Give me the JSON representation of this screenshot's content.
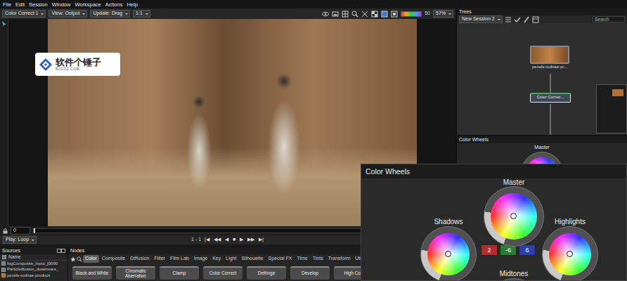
{
  "menu": [
    "File",
    "Edit",
    "Session",
    "Window",
    "Workspace",
    "Actions",
    "Help"
  ],
  "toolbar": {
    "node_select": "Color Correct 1",
    "view": "View: Output",
    "update": "Update: Drag",
    "zoom_ratio": "1:1",
    "exposure": "50",
    "zoom": "57%"
  },
  "watermark": {
    "title": "软件个锤子",
    "url": "RJGCZ.COM"
  },
  "timeline": {
    "frame": "0"
  },
  "playbar": {
    "mode": "Play: Loop",
    "range": "1 - 1",
    "transport": [
      "|◀",
      "◀◀",
      "◀",
      "■",
      "▶",
      "▶▶",
      "▶|"
    ]
  },
  "trees": {
    "title": "Trees",
    "session": "New Session 2",
    "search": "Search",
    "nodes": [
      {
        "label": "pexels-rodnae-pr...",
        "selected": false
      },
      {
        "label": "Color Correc...",
        "selected": true
      }
    ]
  },
  "color_wheels_panel": {
    "title": "Color Wheels",
    "master": "Master"
  },
  "color_wheels_zoom": {
    "title": "Color Wheels",
    "wheels": [
      {
        "name": "Master"
      },
      {
        "name": "Shadows"
      },
      {
        "name": "Highlights"
      },
      {
        "name": "Midtones"
      }
    ],
    "values": [
      {
        "text": "2",
        "color": "#b52a2a"
      },
      {
        "text": "-6",
        "color": "#2d7a35"
      },
      {
        "text": "6",
        "color": "#2a3fa8"
      }
    ]
  },
  "sources": {
    "title": "Sources",
    "column": "Name",
    "items": [
      {
        "name": "fogComposite_Input_[0000",
        "kind": "sequence"
      },
      {
        "name": "ParticleIllusion_dustmotes_",
        "kind": "sequence"
      },
      {
        "name": "pexels-rodnae-producti",
        "kind": "image"
      }
    ]
  },
  "nodes": {
    "title": "Nodes",
    "tabs": [
      {
        "label": "Color",
        "selected": true
      },
      {
        "label": "Composite",
        "selected": false
      },
      {
        "label": "Diffusion",
        "selected": false
      },
      {
        "label": "Filter",
        "selected": false
      },
      {
        "label": "Film Lab",
        "selected": false
      },
      {
        "label": "Image",
        "selected": false
      },
      {
        "label": "Key",
        "selected": false
      },
      {
        "label": "Light",
        "selected": false
      },
      {
        "label": "Silhouette",
        "selected": false
      },
      {
        "label": "Special FX",
        "selected": false
      },
      {
        "label": "Time",
        "selected": false
      },
      {
        "label": "Tints",
        "selected": false
      },
      {
        "label": "Transform",
        "selected": false
      },
      {
        "label": "Utility",
        "selected": false
      }
    ],
    "buttons": [
      "Black and White",
      "Chromatic Aberration",
      "Clamp",
      "Color Correct",
      "Defringe",
      "Develop",
      "High Con"
    ]
  }
}
